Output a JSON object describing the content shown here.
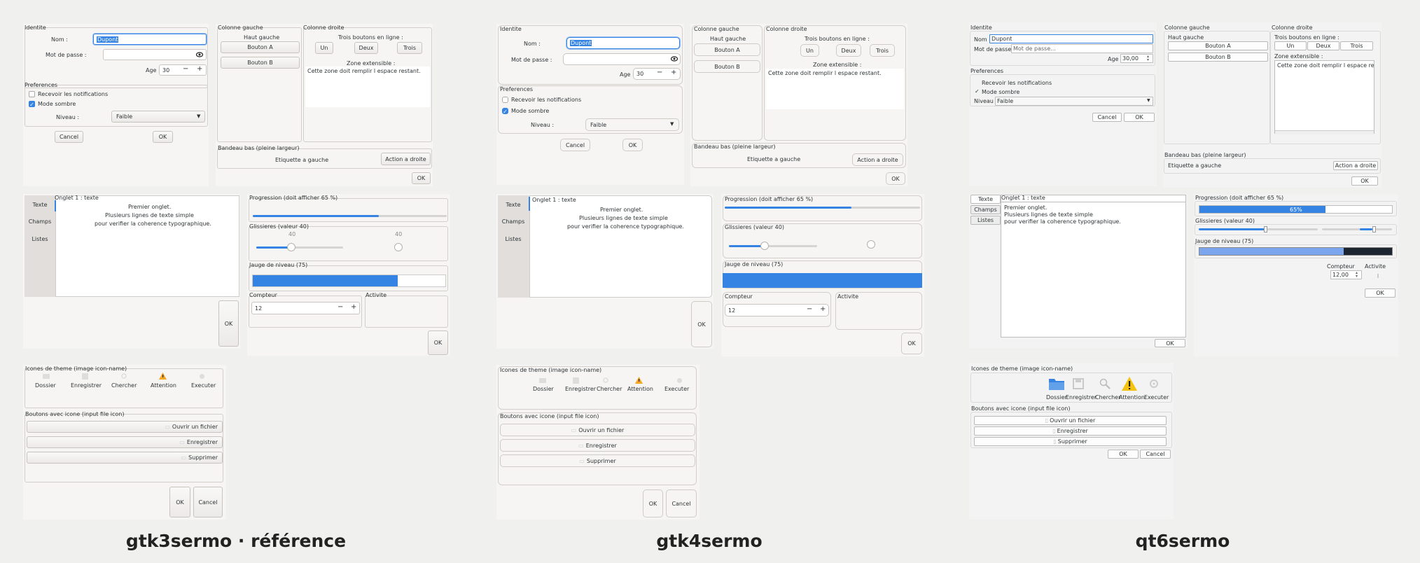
{
  "captions": {
    "gtk3": "gtk3sermo · référence",
    "gtk4": "gtk4sermo",
    "qt6": "qt6sermo"
  },
  "common": {
    "identity_title": "Identite",
    "name_label": "Nom :",
    "name_value": "Dupont",
    "password_label": "Mot de passe :",
    "password_placeholder": "Mot de passe...",
    "age_label": "Age :",
    "age_value_gtk": "30",
    "age_value_qt": "30,00",
    "preferences_title": "Preferences",
    "notifications_label": "Recevoir les notifications",
    "dark_mode_label": "Mode sombre",
    "level_label": "Niveau :",
    "level_value": "Faible",
    "cancel": "Cancel",
    "ok": "OK",
    "left_column_title": "Colonne gauche",
    "top_left_label": "Haut gauche",
    "button_a": "Bouton A",
    "button_b": "Bouton B",
    "right_column_title": "Colonne droite",
    "three_buttons_label": "Trois boutons en ligne :",
    "btn_un": "Un",
    "btn_deux": "Deux",
    "btn_trois": "Trois",
    "extensible_label": "Zone extensible :",
    "extensible_text": "Cette zone doit remplir l espace restant.",
    "banner_title": "Bandeau bas (pleine largeur)",
    "banner_left": "Etiquette a gauche",
    "banner_right": "Action a droite",
    "tabs": [
      "Texte",
      "Champs",
      "Listes"
    ],
    "tab1_title": "Onglet 1 : texte",
    "tab1_line1": "Premier onglet.",
    "tab1_line2": "Plusieurs lignes de texte simple",
    "tab1_line3": "pour verifier la coherence typographique.",
    "progress_title": "Progression (doit afficher 65 %)",
    "progress_value": 0.65,
    "progress_text": "65%",
    "sliders_title": "Glissieres (valeur 40)",
    "slider_value": "40",
    "level_gauge_title": "Jauge de niveau (75)",
    "level_gauge_value": 0.75,
    "counter_title": "Compteur",
    "counter_value": "12",
    "counter_value_qt": "12,00",
    "activity_title": "Activite",
    "icons_title": "Icones de theme (image icon-name)",
    "icons": [
      "Dossier",
      "Enregistrer",
      "Chercher",
      "Attention",
      "Executer"
    ],
    "file_buttons_title": "Boutons avec icone (input file icon)",
    "file_buttons": [
      "Ouvrir un fichier",
      "Enregistrer",
      "Supprimer"
    ],
    "minus": "−",
    "plus": "+"
  },
  "colors": {
    "accent": "#3584e4",
    "warning": "#f5a623",
    "qt_accent": "#3584e4"
  }
}
